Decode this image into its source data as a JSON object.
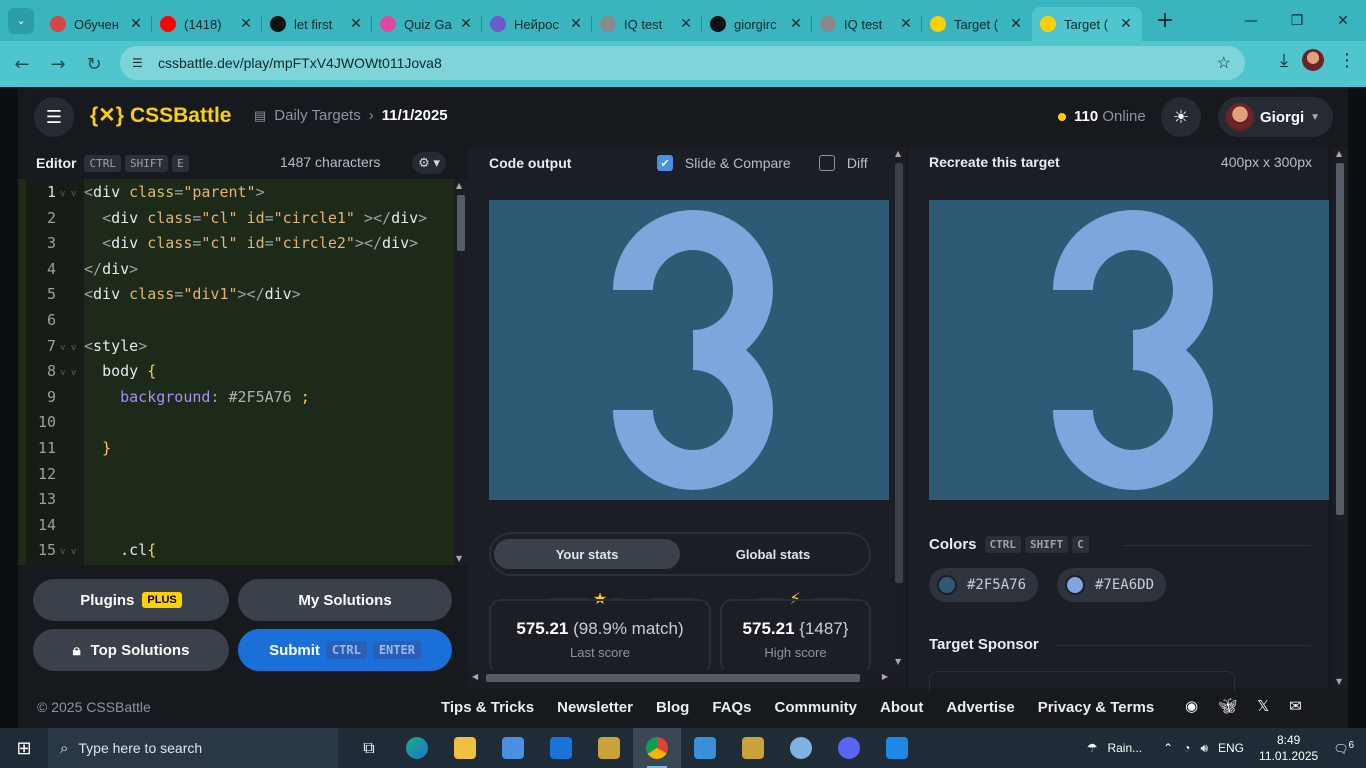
{
  "browser": {
    "tabs": [
      {
        "title": "Обучен",
        "color": "#d94444"
      },
      {
        "title": "(1418) ",
        "color": "#ff0000"
      },
      {
        "title": "let first",
        "color": "#111111"
      },
      {
        "title": "Quiz Ga",
        "color": "#e04a9a"
      },
      {
        "title": "Нейрос",
        "color": "#6a5acd"
      },
      {
        "title": "IQ test",
        "color": "#888888"
      },
      {
        "title": "giorgirc",
        "color": "#111111"
      },
      {
        "title": "IQ test",
        "color": "#888888"
      },
      {
        "title": "Target (",
        "color": "#ffd000"
      },
      {
        "title": "Target (",
        "color": "#ffd000"
      }
    ],
    "url": "cssbattle.dev/play/mpFTxV4JWOWt011Jova8"
  },
  "header": {
    "logo": "CSSBattle",
    "logo_mark": "{✕}",
    "breadcrumb_section": "Daily Targets",
    "breadcrumb_date": "11/1/2025",
    "online_count": "110",
    "online_label": "Online",
    "user_name": "Giorgi"
  },
  "editor": {
    "title": "Editor",
    "shortcut": [
      "CTRL",
      "SHIFT",
      "E"
    ],
    "char_count": "1487 characters",
    "line_numbers": [
      "1",
      "2",
      "3",
      "4",
      "5",
      "6",
      "7",
      "8",
      "9",
      "10",
      "11",
      "12",
      "13",
      "14",
      "15"
    ]
  },
  "buttons": {
    "plugins": "Plugins",
    "plugins_badge": "PLUS",
    "my_solutions": "My Solutions",
    "top_solutions": "Top Solutions",
    "submit": "Submit",
    "submit_shortcut": [
      "CTRL",
      "ENTER"
    ]
  },
  "output": {
    "title": "Code output",
    "slide_compare": "Slide & Compare",
    "slide_compare_checked": true,
    "diff": "Diff",
    "diff_checked": false,
    "tab_your_stats": "Your stats",
    "tab_global_stats": "Global stats",
    "last_score_value": "575.21",
    "last_score_match": "(98.9% match)",
    "last_score_label": "Last score",
    "high_score_value": "575.21",
    "high_score_chars": "{1487}",
    "high_score_label": "High score"
  },
  "target": {
    "title": "Recreate this target",
    "size": "400px x 300px",
    "colors_label": "Colors",
    "colors_shortcut": [
      "CTRL",
      "SHIFT",
      "C"
    ],
    "colors": [
      "#2F5A76",
      "#7EA6DD"
    ],
    "sponsor_label": "Target Sponsor"
  },
  "footer": {
    "copyright": "© 2025 CSSBattle",
    "links": [
      "Tips & Tricks",
      "Newsletter",
      "Blog",
      "FAQs",
      "Community",
      "About",
      "Advertise",
      "Privacy & Terms"
    ]
  },
  "taskbar": {
    "search_placeholder": "Type here to search",
    "weather": "Rain...",
    "language": "ENG",
    "time": "8:49",
    "date": "11.01.2025",
    "notifications": "6"
  }
}
